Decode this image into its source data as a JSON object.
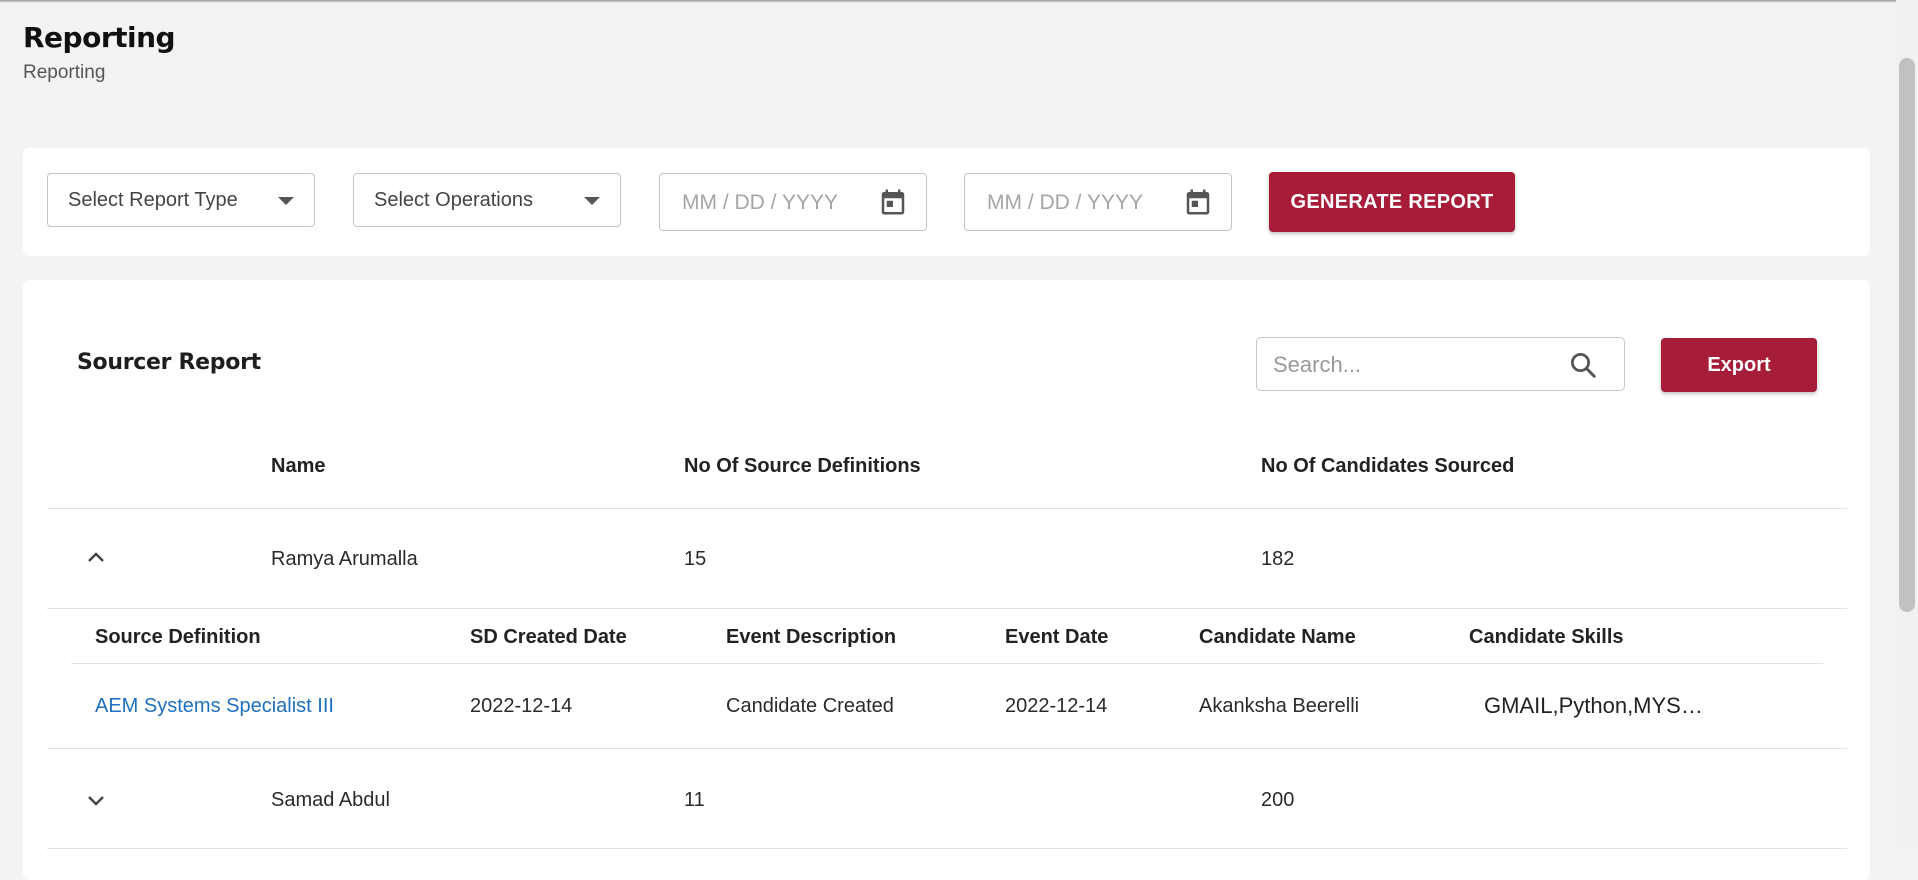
{
  "header": {
    "title": "Reporting",
    "breadcrumb": "Reporting"
  },
  "filters": {
    "report_type_placeholder": "Select Report Type",
    "operations_placeholder": "Select Operations",
    "start_date_placeholder": "MM / DD / YYYY",
    "end_date_placeholder": "MM / DD / YYYY",
    "generate_label": "GENERATE REPORT"
  },
  "report": {
    "title": "Sourcer Report",
    "search_placeholder": "Search...",
    "export_label": "Export",
    "columns": [
      "Name",
      "No Of Source Definitions",
      "No Of Candidates Sourced"
    ],
    "rows": [
      {
        "name": "Ramya Arumalla",
        "source_definitions": "15",
        "candidates_sourced": "182",
        "expanded": true
      },
      {
        "name": "Samad Abdul",
        "source_definitions": "11",
        "candidates_sourced": "200",
        "expanded": false
      }
    ],
    "detail": {
      "columns": [
        "Source Definition",
        "SD Created Date",
        "Event Description",
        "Event Date",
        "Candidate Name",
        "Candidate Skills"
      ],
      "rows": [
        {
          "source_definition": "AEM Systems Specialist III",
          "sd_created_date": "2022-12-14",
          "event_description": "Candidate Created",
          "event_date": "2022-12-14",
          "candidate_name": "Akanksha Beerelli",
          "candidate_skills": "GMAIL,Python,MYSQL"
        }
      ]
    }
  },
  "colors": {
    "brand": "#a71c38",
    "link": "#1f6fbf",
    "background": "#f3f3f3"
  }
}
